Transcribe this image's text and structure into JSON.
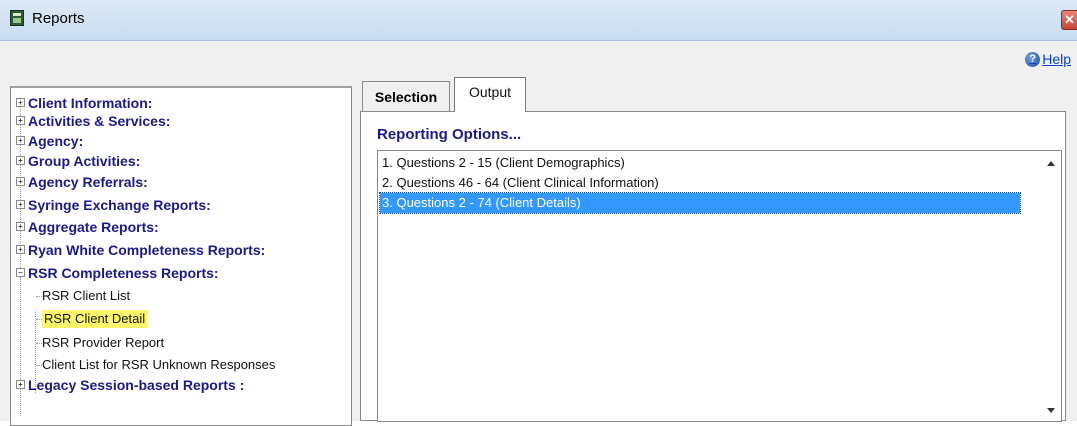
{
  "window": {
    "title": "Reports",
    "close_glyph": "✕"
  },
  "toolbar": {
    "help_label": "Help",
    "help_glyph": "?"
  },
  "tree": {
    "categories": [
      {
        "label": "Client Information:",
        "expanded": false
      },
      {
        "label": "Activities & Services:",
        "expanded": false
      },
      {
        "label": "Agency:",
        "expanded": false
      },
      {
        "label": "Group Activities:",
        "expanded": false
      },
      {
        "label": "Agency Referrals:",
        "expanded": false
      },
      {
        "label": "Syringe Exchange Reports:",
        "expanded": false
      },
      {
        "label": "Aggregate Reports:",
        "expanded": false
      },
      {
        "label": "Ryan White Completeness Reports:",
        "expanded": false
      },
      {
        "label": "RSR Completeness Reports:",
        "expanded": true
      }
    ],
    "rsr_children": [
      {
        "label": "RSR Client List",
        "selected": false
      },
      {
        "label": "RSR Client Detail",
        "selected": true
      },
      {
        "label": "RSR Provider Report",
        "selected": false
      },
      {
        "label": "Client List for RSR Unknown Responses",
        "selected": false
      }
    ],
    "last_category": {
      "label": "Legacy Session-based Reports :",
      "expanded": false
    },
    "highlight_color": "#fdf66a"
  },
  "tabs": {
    "selection_label": "Selection",
    "output_label": "Output",
    "active": "Output"
  },
  "output": {
    "section_label": "Reporting Options...",
    "options": [
      "1. Questions 2 - 15  (Client Demographics)",
      "2. Questions 46 - 64  (Client Clinical Information)",
      "3. Questions 2 - 74  (Client Details)"
    ],
    "selected_index": 2,
    "selection_color": "#3399ff"
  }
}
